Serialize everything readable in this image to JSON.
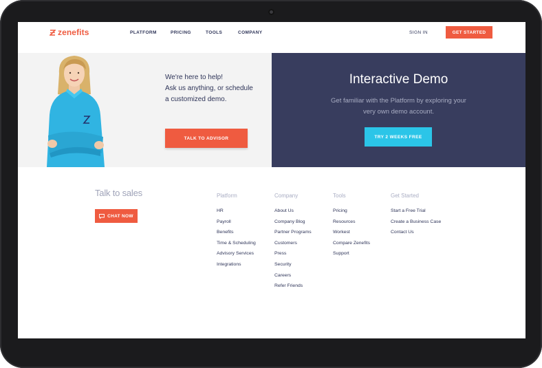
{
  "header": {
    "logo_text": "zenefits",
    "nav": [
      "PLATFORM",
      "PRICING",
      "TOOLS",
      "COMPANY"
    ],
    "sign_in": "SIGN IN",
    "get_started": "GET STARTED"
  },
  "hero_left": {
    "lines": [
      "We're here to help!",
      "Ask us anything, or schedule",
      "a customized demo."
    ],
    "button": "TALK TO ADVISOR"
  },
  "hero_right": {
    "title": "Interactive Demo",
    "subtitle_lines": [
      "Get familiar with the Platform by exploring your",
      "very own demo account."
    ],
    "button": "TRY 2 WEEKS FREE"
  },
  "footer": {
    "sales_title": "Talk to sales",
    "chat_button": "CHAT NOW",
    "columns": [
      {
        "title": "Platform",
        "links": [
          "HR",
          "Payroll",
          "Benefits",
          "Time & Scheduling",
          "Advisory Services",
          "Integrations"
        ]
      },
      {
        "title": "Company",
        "links": [
          "About Us",
          "Company Blog",
          "Partner Programs",
          "Customers",
          "Press",
          "Security",
          "Careers",
          "Refer Friends"
        ]
      },
      {
        "title": "Tools",
        "links": [
          "Pricing",
          "Resources",
          "Workest",
          "Compare Zenefits",
          "Support"
        ]
      },
      {
        "title": "Get Started",
        "links": [
          "Start a Free Trial",
          "Create a Business Case",
          "Contact Us"
        ]
      }
    ]
  },
  "colors": {
    "brand": "#ef5b40",
    "navy": "#383d5e",
    "cyan": "#2bc5e8",
    "text": "#2e3458"
  },
  "icons": [
    "zenefits-logo-icon",
    "chat-icon",
    "person-photo"
  ]
}
